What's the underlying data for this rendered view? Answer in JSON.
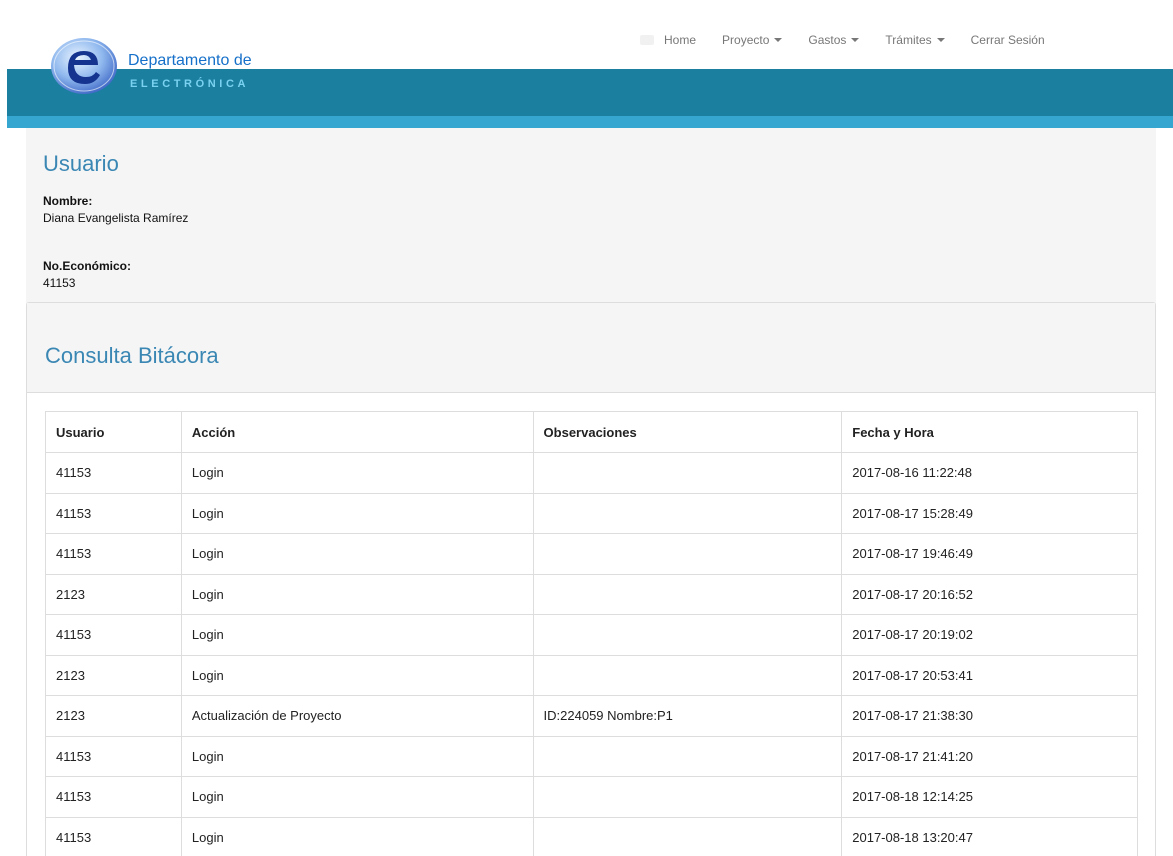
{
  "brand": {
    "line1": "Departamento de",
    "line2": "ELECTRÓNICA",
    "colors": {
      "band": "#1b7fa0",
      "band_light": "#35a6d0",
      "title": "#3a87b4"
    }
  },
  "nav": {
    "items": [
      {
        "label": "Home",
        "dropdown": false
      },
      {
        "label": "Proyecto",
        "dropdown": true
      },
      {
        "label": "Gastos",
        "dropdown": true
      },
      {
        "label": "Trámites",
        "dropdown": true
      },
      {
        "label": "Cerrar Sesión",
        "dropdown": false
      }
    ]
  },
  "user": {
    "title": "Usuario",
    "name_label": "Nombre:",
    "name_value": "Diana Evangelista Ramírez",
    "number_label": "No.Económico:",
    "number_value": "41153"
  },
  "log": {
    "title": "Consulta Bitácora",
    "headers": [
      "Usuario",
      "Acción",
      "Observaciones",
      "Fecha y Hora"
    ],
    "rows": [
      [
        "41153",
        "Login",
        "",
        "2017-08-16 11:22:48"
      ],
      [
        "41153",
        "Login",
        "",
        "2017-08-17 15:28:49"
      ],
      [
        "41153",
        "Login",
        "",
        "2017-08-17 19:46:49"
      ],
      [
        "2123",
        "Login",
        "",
        "2017-08-17 20:16:52"
      ],
      [
        "41153",
        "Login",
        "",
        "2017-08-17 20:19:02"
      ],
      [
        "2123",
        "Login",
        "",
        "2017-08-17 20:53:41"
      ],
      [
        "2123",
        "Actualización de Proyecto",
        "ID:224059 Nombre:P1",
        "2017-08-17 21:38:30"
      ],
      [
        "41153",
        "Login",
        "",
        "2017-08-17 21:41:20"
      ],
      [
        "41153",
        "Login",
        "",
        "2017-08-18 12:14:25"
      ],
      [
        "41153",
        "Login",
        "",
        "2017-08-18 13:20:47"
      ]
    ]
  }
}
